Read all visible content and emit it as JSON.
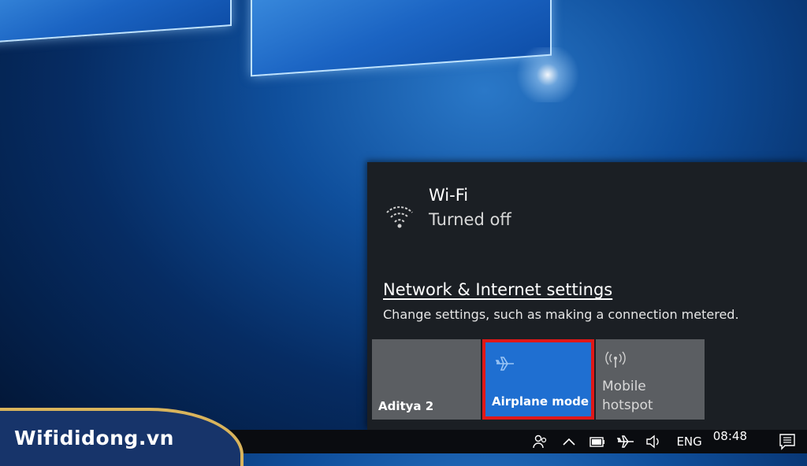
{
  "network_flyout": {
    "wifi": {
      "icon": "wifi-off-icon",
      "name": "Wi-Fi",
      "status": "Turned off"
    },
    "settings_link": "Network & Internet settings",
    "settings_description": "Change settings, such as making a connection metered.",
    "tiles": [
      {
        "label": "Aditya 2"
      },
      {
        "label": "Airplane mode",
        "icon": "airplane-icon",
        "active": true,
        "highlight_color": "#e01818"
      },
      {
        "label_line1": "Mobile",
        "label_line2": "hotspot",
        "icon": "hotspot-icon"
      }
    ]
  },
  "taskbar": {
    "tray_icons": [
      "people-icon",
      "chevron-up-icon",
      "battery-icon",
      "airplane-icon",
      "volume-icon"
    ],
    "language": "ENG",
    "time": "08:48",
    "notification_icon": "action-center-icon"
  },
  "watermark": {
    "text": "Wifididong.vn"
  },
  "colors": {
    "accent": "#1f6fd1",
    "highlight": "#e01818",
    "flyout_bg": "#1b1f24"
  }
}
